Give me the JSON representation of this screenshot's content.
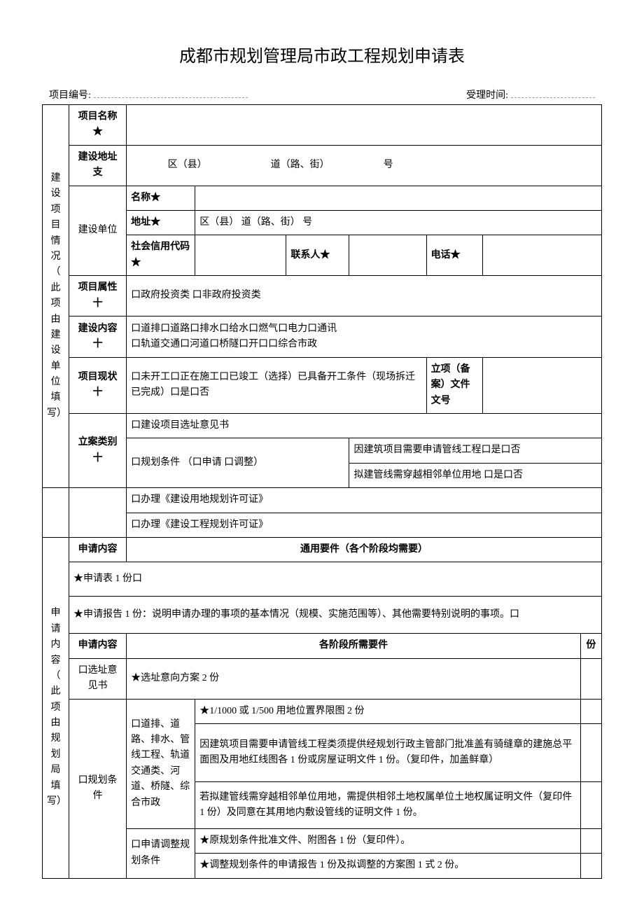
{
  "title": "成都市规划管理局市政工程规划申请表",
  "meta": {
    "projectNoLabel": "项目编号:",
    "acceptTimeLabel": "受理时间:"
  },
  "section1": {
    "vlabel": "建设项目情况（   此项由建设单位填写）",
    "rows": {
      "projName": "项目名称★",
      "addrBranch": "建设地址支",
      "addrLine": "               区（县）                          道（路、街）                      号",
      "unit": "建设单位",
      "unitName": "名称★",
      "unitAddr": "地址★",
      "unitAddrLine": "区（县）         道（路、街）         号",
      "socialCode": "社会信用代码★",
      "contact": "联系人★",
      "phone": "电话★",
      "attr": "项目属性十",
      "attrLine": "口政府投资类      口非政府投资类",
      "content": "建设内容十",
      "contentLine": "口道排口道路口排水口给水口燃气口电力口通讯\n口轨道交通口河道口桥隧口开口口综合市政",
      "status": "项目现状十",
      "statusLine": "口未开工口正在施工口已竣工（选择）已具备开工条件（现场拆迁已完成）口是口否",
      "filingLabel": "立项（备案）文件文号",
      "caseType": "立案类别十",
      "case1": "口建设项目选址意见书",
      "case2a": "口规划条件     （口申请      口调整）",
      "case2b1": "因建筑项目需要申请管线工程口是口否",
      "case2b2": "拟建管线需穿越相邻单位用地       口是口否",
      "case3": "口办理《建设用地规划许可证》",
      "case4": "口办理《建设工程规划许可证》"
    }
  },
  "section2": {
    "vlabel": "申请内容（   此项由规划局填写）",
    "appContent": "申请内容",
    "header1": "通用要件（各个阶段均需要）",
    "line1": "★申请表 1 份口",
    "line2": "★申请报告 1 份：说明申请办理的事项的基本情况（规模、实施范围等）、其他需要特别说明的事项。口",
    "header2": "各阶段所需要件",
    "copies": "份",
    "r1label": "口选址意见书",
    "r1text": "★选址意向方案 2 份",
    "r2label": "口规划条件",
    "r2sub1": "口道排、道路、排水、管线工程、轨道交通类、河道、桥隧、综合市政",
    "r2a": "★1/1000 或 1/500 用地位置界限图 2 份",
    "r2b": "因建筑项目需要申请管线工程类须提供经规划行政主管部门批准盖有骑缝章的建施总平面图及用地红线图各 1 份或房屋证明文件 1 份。（复印件，加盖鲜章）",
    "r2c": "若拟建管线需穿越相邻单位用地，需提供相邻土地权属单位土地权属证明文件（复印件 1 份）及同意在其用地内敷设管线的证明文件 1 份。",
    "r2sub2": "口申请调整规划条件",
    "r2d": "★原规划条件批准文件、附图各 1 份（复印件）。",
    "r2e": "★调整规划条件的申请报告 1 份及拟调整的方案图 1 式 2 份。"
  }
}
